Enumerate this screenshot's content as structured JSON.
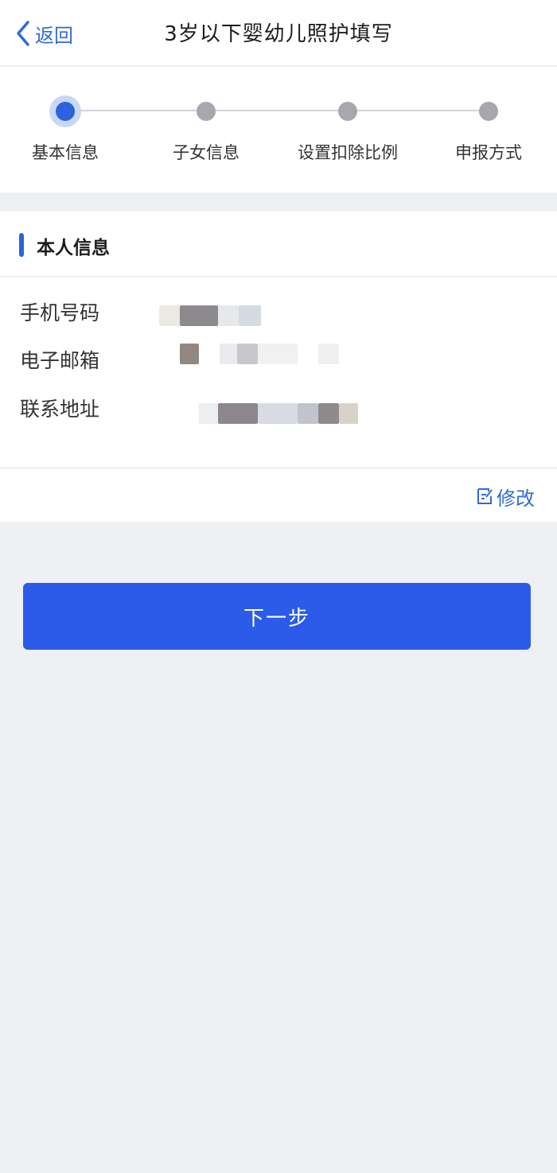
{
  "header": {
    "back_label": "返回",
    "title": "3岁以下婴幼儿照护填写"
  },
  "steps": [
    {
      "label": "基本信息",
      "active": true
    },
    {
      "label": "子女信息",
      "active": false
    },
    {
      "label": "设置扣除比例",
      "active": false
    },
    {
      "label": "申报方式",
      "active": false
    }
  ],
  "section": {
    "title": "本人信息",
    "fields": [
      {
        "label": "手机号码"
      },
      {
        "label": "电子邮箱"
      },
      {
        "label": "联系地址"
      }
    ],
    "edit_label": "修改"
  },
  "next_button": "下一步",
  "colors": {
    "accent": "#2a63dc",
    "button": "#2b5be8",
    "link": "#2f6bd8",
    "inactive_dot": "#a6a8ae",
    "background": "#eef0f4"
  },
  "icons": {
    "back": "chevron-left-icon",
    "edit": "edit-icon"
  }
}
